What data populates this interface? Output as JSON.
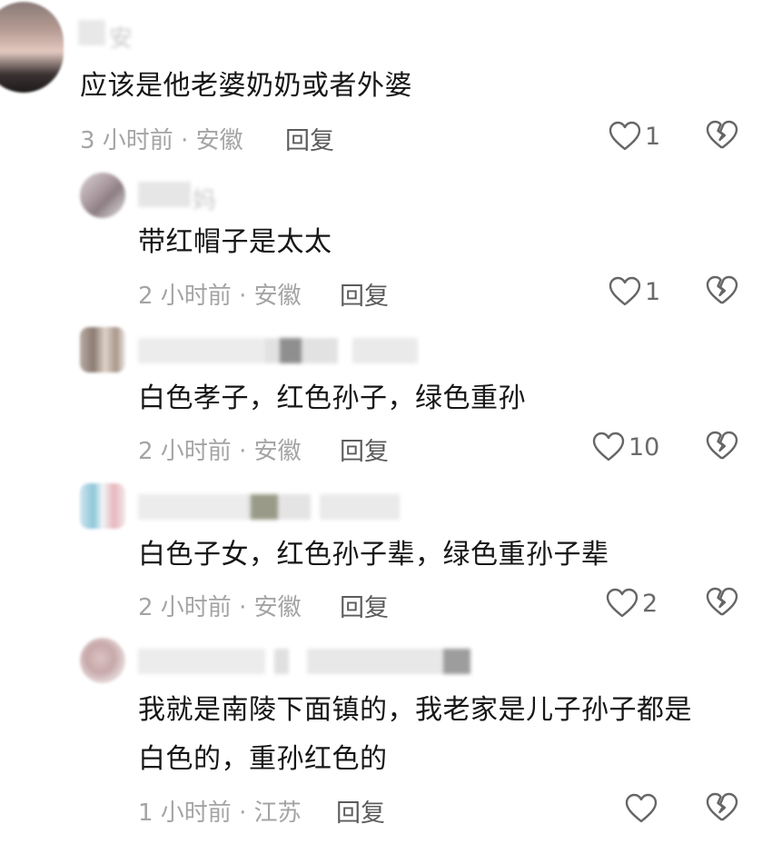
{
  "comments": [
    {
      "name": "安",
      "text": "应该是他老婆奶奶或者外婆",
      "meta": "3 小时前 · 安徽",
      "reply_label": "回复",
      "likes": "1"
    },
    {
      "name": "妈",
      "text": "带红帽子是太太",
      "meta": "2 小时前 · 安徽",
      "reply_label": "回复",
      "likes": "1"
    },
    {
      "name": "",
      "text": "白色孝子，红色孙子，绿色重孙",
      "meta": "2 小时前 · 安徽",
      "reply_label": "回复",
      "likes": "10"
    },
    {
      "name": "",
      "text": "白色子女，红色孙子辈，绿色重孙子辈",
      "meta": "2 小时前 · 安徽",
      "reply_label": "回复",
      "likes": "2"
    },
    {
      "name": "",
      "text_line1": "我就是南陵下面镇的，我老家是儿子孙子都是",
      "text_line2": "白色的，重孙红色的",
      "meta": "1 小时前 · 江苏",
      "reply_label": "回复",
      "likes": ""
    }
  ],
  "icons": {
    "like": "heart-outline-icon",
    "dislike": "broken-heart-icon"
  },
  "colors": {
    "text": "#161616",
    "meta": "#a4a4a4",
    "reply": "#5c5c5c",
    "icon": "#666666"
  }
}
